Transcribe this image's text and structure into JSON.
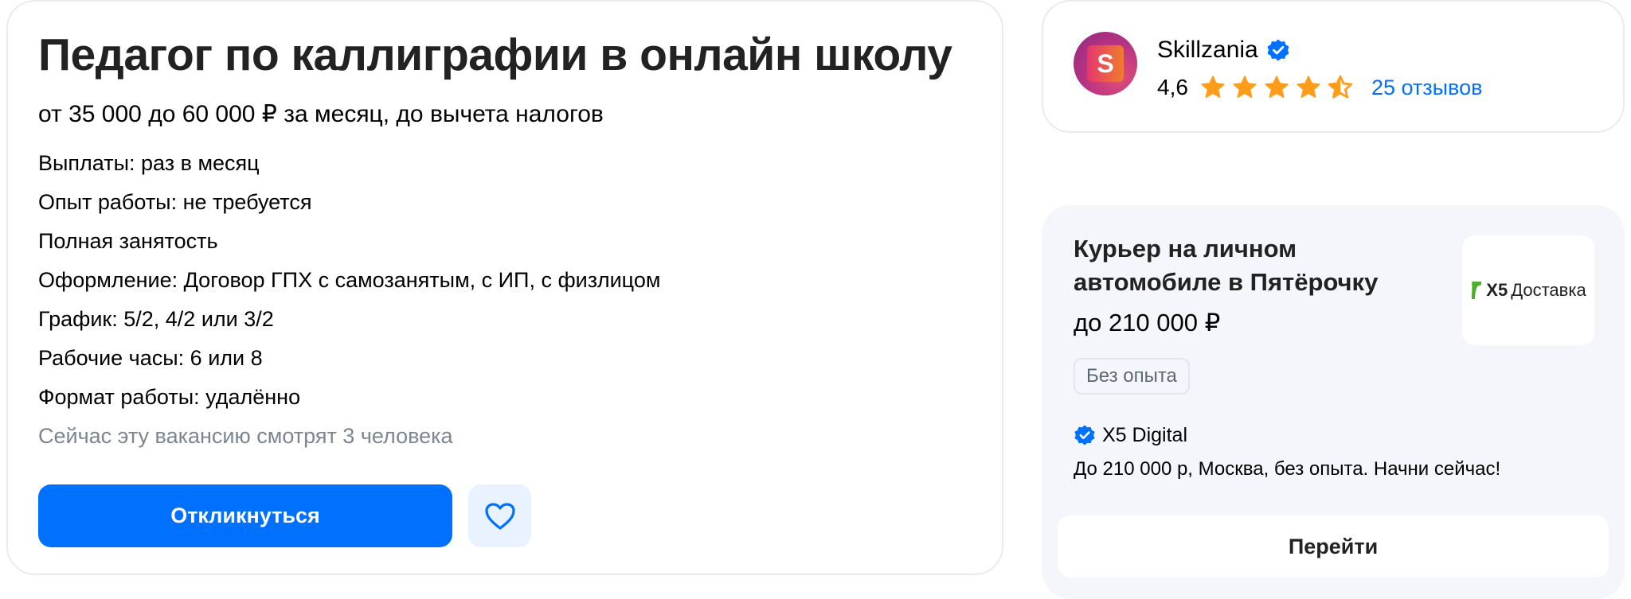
{
  "vacancy": {
    "title": "Педагог по каллиграфии в онлайн школу",
    "salary": "от 35 000 до 60 000 ₽ за месяц, до вычета налогов",
    "details": [
      "Выплаты: раз в месяц",
      "Опыт работы: не требуется",
      "Полная занятость",
      "Оформление: Договор ГПХ с самозанятым, с ИП, с физлицом",
      "График: 5/2, 4/2 или 3/2",
      "Рабочие часы: 6 или 8",
      "Формат работы: удалённо"
    ],
    "viewers": "Сейчас эту вакансию смотрят 3 человека",
    "respond_label": "Откликнуться",
    "favorite_icon": "heart-icon"
  },
  "employer": {
    "name": "Skillzania",
    "logo_letter": "S",
    "verified_icon": "verified-badge-icon",
    "rating": "4,6",
    "stars": 4.5,
    "reviews": "25 отзывов"
  },
  "ad": {
    "title": "Курьер на личном автомобиле в Пятёрочку",
    "salary": "до 210 000 ₽",
    "tag": "Без опыта",
    "logo_text_x5": "X5",
    "logo_text_delivery": "Доставка",
    "company": "X5 Digital",
    "description": "До 210 000 р, Москва, без опыта. Начни сейчас!",
    "button_label": "Перейти"
  },
  "colors": {
    "accent_blue": "#0070ff",
    "star_orange": "#ff9c1a",
    "muted_text": "#7c8693",
    "x5_green": "#4caf29"
  }
}
